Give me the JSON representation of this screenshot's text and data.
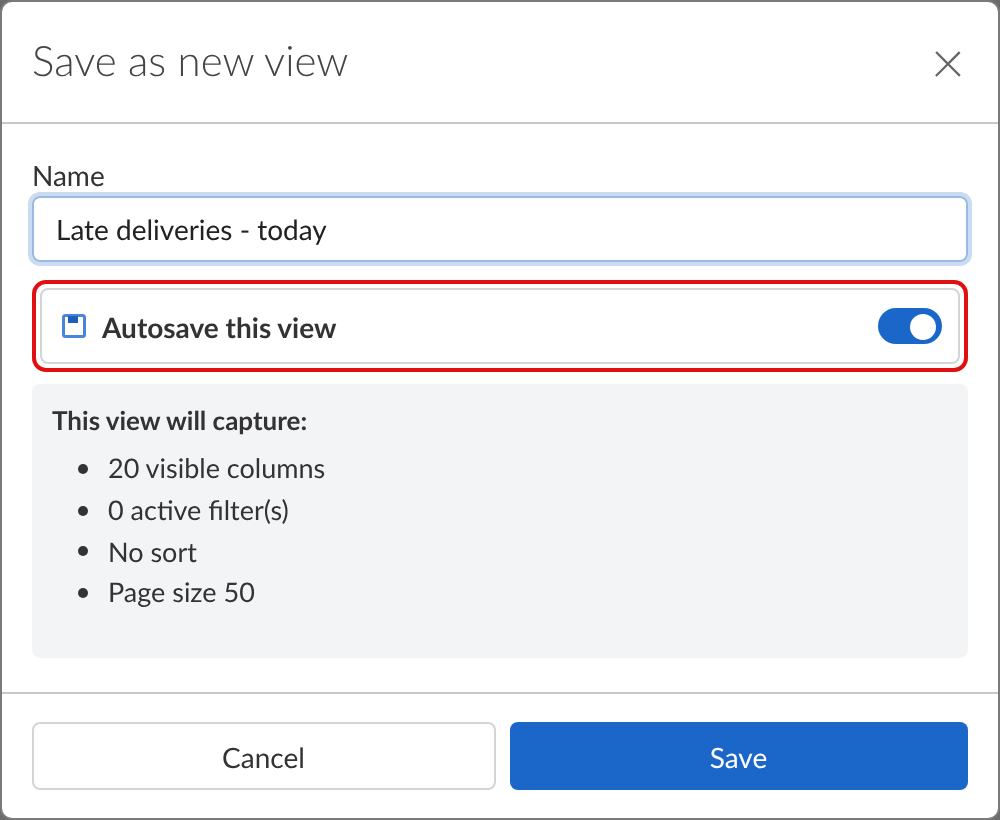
{
  "dialog": {
    "title": "Save as new view",
    "close_label": "×"
  },
  "name_field": {
    "label": "Name",
    "value": "Late deliveries - today"
  },
  "autosave": {
    "label": "Autosave this view",
    "on": true,
    "highlighted": true
  },
  "summary": {
    "heading": "This view will capture:",
    "items": [
      "20 visible columns",
      "0 active filter(s)",
      "No sort",
      "Page size 50"
    ]
  },
  "buttons": [
    {
      "label": "Cancel",
      "kind": "secondary"
    },
    {
      "label": "Save",
      "kind": "primary"
    }
  ]
}
